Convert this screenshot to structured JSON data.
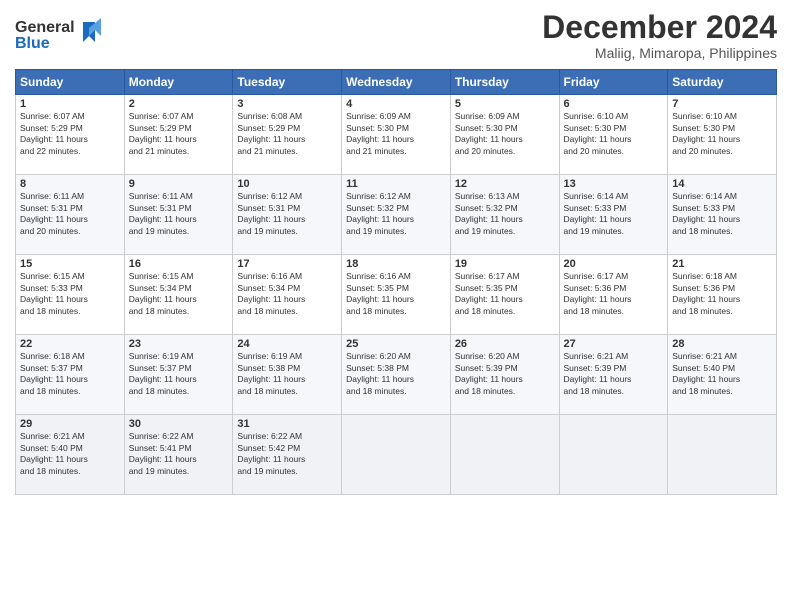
{
  "logo": {
    "line1": "General",
    "line2": "Blue"
  },
  "header": {
    "month": "December 2024",
    "location": "Maliig, Mimaropa, Philippines"
  },
  "weekdays": [
    "Sunday",
    "Monday",
    "Tuesday",
    "Wednesday",
    "Thursday",
    "Friday",
    "Saturday"
  ],
  "weeks": [
    [
      {
        "day": "1",
        "content": "Sunrise: 6:07 AM\nSunset: 5:29 PM\nDaylight: 11 hours\nand 22 minutes."
      },
      {
        "day": "2",
        "content": "Sunrise: 6:07 AM\nSunset: 5:29 PM\nDaylight: 11 hours\nand 21 minutes."
      },
      {
        "day": "3",
        "content": "Sunrise: 6:08 AM\nSunset: 5:29 PM\nDaylight: 11 hours\nand 21 minutes."
      },
      {
        "day": "4",
        "content": "Sunrise: 6:09 AM\nSunset: 5:30 PM\nDaylight: 11 hours\nand 21 minutes."
      },
      {
        "day": "5",
        "content": "Sunrise: 6:09 AM\nSunset: 5:30 PM\nDaylight: 11 hours\nand 20 minutes."
      },
      {
        "day": "6",
        "content": "Sunrise: 6:10 AM\nSunset: 5:30 PM\nDaylight: 11 hours\nand 20 minutes."
      },
      {
        "day": "7",
        "content": "Sunrise: 6:10 AM\nSunset: 5:30 PM\nDaylight: 11 hours\nand 20 minutes."
      }
    ],
    [
      {
        "day": "8",
        "content": "Sunrise: 6:11 AM\nSunset: 5:31 PM\nDaylight: 11 hours\nand 20 minutes."
      },
      {
        "day": "9",
        "content": "Sunrise: 6:11 AM\nSunset: 5:31 PM\nDaylight: 11 hours\nand 19 minutes."
      },
      {
        "day": "10",
        "content": "Sunrise: 6:12 AM\nSunset: 5:31 PM\nDaylight: 11 hours\nand 19 minutes."
      },
      {
        "day": "11",
        "content": "Sunrise: 6:12 AM\nSunset: 5:32 PM\nDaylight: 11 hours\nand 19 minutes."
      },
      {
        "day": "12",
        "content": "Sunrise: 6:13 AM\nSunset: 5:32 PM\nDaylight: 11 hours\nand 19 minutes."
      },
      {
        "day": "13",
        "content": "Sunrise: 6:14 AM\nSunset: 5:33 PM\nDaylight: 11 hours\nand 19 minutes."
      },
      {
        "day": "14",
        "content": "Sunrise: 6:14 AM\nSunset: 5:33 PM\nDaylight: 11 hours\nand 18 minutes."
      }
    ],
    [
      {
        "day": "15",
        "content": "Sunrise: 6:15 AM\nSunset: 5:33 PM\nDaylight: 11 hours\nand 18 minutes."
      },
      {
        "day": "16",
        "content": "Sunrise: 6:15 AM\nSunset: 5:34 PM\nDaylight: 11 hours\nand 18 minutes."
      },
      {
        "day": "17",
        "content": "Sunrise: 6:16 AM\nSunset: 5:34 PM\nDaylight: 11 hours\nand 18 minutes."
      },
      {
        "day": "18",
        "content": "Sunrise: 6:16 AM\nSunset: 5:35 PM\nDaylight: 11 hours\nand 18 minutes."
      },
      {
        "day": "19",
        "content": "Sunrise: 6:17 AM\nSunset: 5:35 PM\nDaylight: 11 hours\nand 18 minutes."
      },
      {
        "day": "20",
        "content": "Sunrise: 6:17 AM\nSunset: 5:36 PM\nDaylight: 11 hours\nand 18 minutes."
      },
      {
        "day": "21",
        "content": "Sunrise: 6:18 AM\nSunset: 5:36 PM\nDaylight: 11 hours\nand 18 minutes."
      }
    ],
    [
      {
        "day": "22",
        "content": "Sunrise: 6:18 AM\nSunset: 5:37 PM\nDaylight: 11 hours\nand 18 minutes."
      },
      {
        "day": "23",
        "content": "Sunrise: 6:19 AM\nSunset: 5:37 PM\nDaylight: 11 hours\nand 18 minutes."
      },
      {
        "day": "24",
        "content": "Sunrise: 6:19 AM\nSunset: 5:38 PM\nDaylight: 11 hours\nand 18 minutes."
      },
      {
        "day": "25",
        "content": "Sunrise: 6:20 AM\nSunset: 5:38 PM\nDaylight: 11 hours\nand 18 minutes."
      },
      {
        "day": "26",
        "content": "Sunrise: 6:20 AM\nSunset: 5:39 PM\nDaylight: 11 hours\nand 18 minutes."
      },
      {
        "day": "27",
        "content": "Sunrise: 6:21 AM\nSunset: 5:39 PM\nDaylight: 11 hours\nand 18 minutes."
      },
      {
        "day": "28",
        "content": "Sunrise: 6:21 AM\nSunset: 5:40 PM\nDaylight: 11 hours\nand 18 minutes."
      }
    ],
    [
      {
        "day": "29",
        "content": "Sunrise: 6:21 AM\nSunset: 5:40 PM\nDaylight: 11 hours\nand 18 minutes."
      },
      {
        "day": "30",
        "content": "Sunrise: 6:22 AM\nSunset: 5:41 PM\nDaylight: 11 hours\nand 19 minutes."
      },
      {
        "day": "31",
        "content": "Sunrise: 6:22 AM\nSunset: 5:42 PM\nDaylight: 11 hours\nand 19 minutes."
      },
      {
        "day": "",
        "content": ""
      },
      {
        "day": "",
        "content": ""
      },
      {
        "day": "",
        "content": ""
      },
      {
        "day": "",
        "content": ""
      }
    ]
  ]
}
